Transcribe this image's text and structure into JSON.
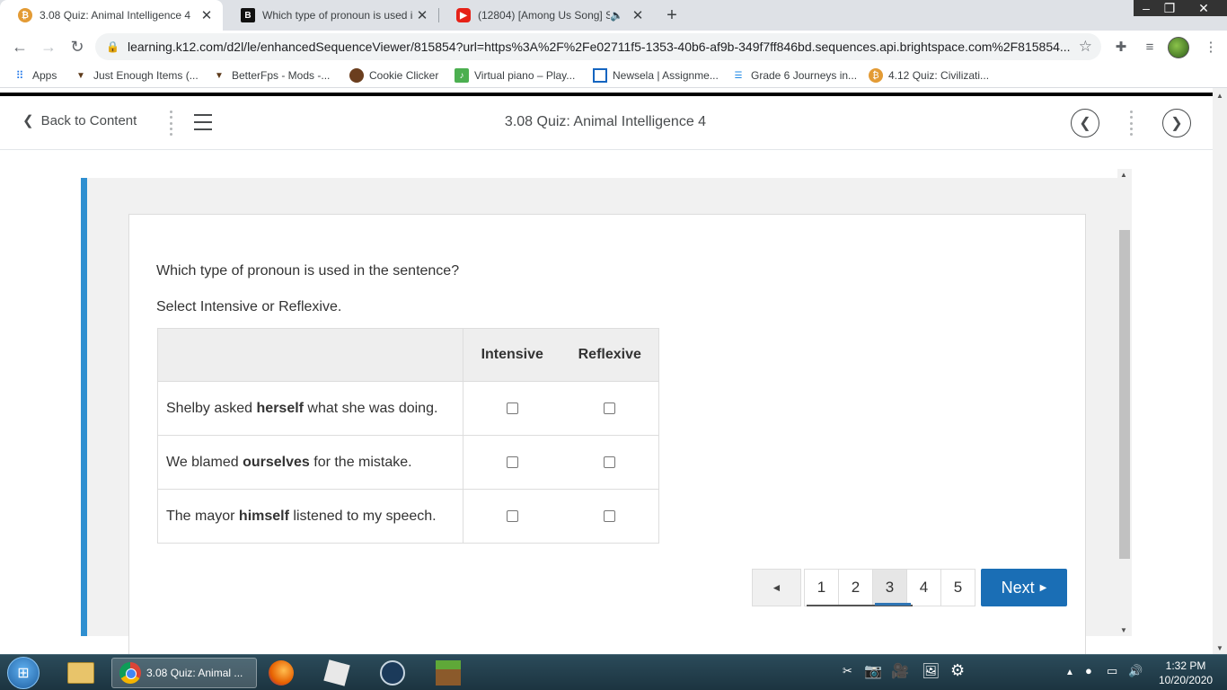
{
  "browser": {
    "tabs": [
      {
        "title": "3.08 Quiz: Animal Intelligence 4",
        "favicon": "k12-icon",
        "active": true
      },
      {
        "title": "Which type of pronoun is used in",
        "favicon": "brainly-icon",
        "active": false
      },
      {
        "title": "(12804) [Among Us Song] Sh",
        "favicon": "youtube-icon",
        "active": false
      }
    ],
    "new_tab": "+",
    "url": "learning.k12.com/d2l/le/enhancedSequenceViewer/815854?url=https%3A%2F%2Fe02711f5-1353-40b6-af9b-349f7ff846bd.sequences.api.brightspace.com%2F815854...",
    "bookmarks": [
      {
        "label": "Apps",
        "icon": "apps-grid-icon"
      },
      {
        "label": "Just Enough Items (...",
        "icon": "anvil-icon"
      },
      {
        "label": "BetterFps - Mods -...",
        "icon": "anvil-icon"
      },
      {
        "label": "Cookie Clicker",
        "icon": "cookie-icon"
      },
      {
        "label": "Virtual piano – Play...",
        "icon": "music-note-icon"
      },
      {
        "label": "Newsela | Assignme...",
        "icon": "newsela-icon"
      },
      {
        "label": "Grade 6 Journeys in...",
        "icon": "stack-icon"
      },
      {
        "label": "4.12 Quiz: Civilizati...",
        "icon": "k12-icon"
      }
    ]
  },
  "nav": {
    "back_label": "Back to Content",
    "title": "3.08 Quiz: Animal Intelligence 4"
  },
  "quiz": {
    "question": "Which type of pronoun is used in the sentence?",
    "instruction": "Select Intensive or Reflexive.",
    "columns": [
      "Intensive",
      "Reflexive"
    ],
    "rows": [
      {
        "before": "Shelby asked ",
        "bold": "herself",
        "after": " what she was doing."
      },
      {
        "before": "We blamed ",
        "bold": "ourselves",
        "after": " for the mistake."
      },
      {
        "before": "The mayor ",
        "bold": "himself",
        "after": " listened to my speech."
      }
    ]
  },
  "pager": {
    "prev": "◄",
    "pages": [
      "1",
      "2",
      "3",
      "4",
      "5"
    ],
    "current_page": "3",
    "next_label": "Next"
  },
  "taskbar": {
    "active_window": "3.08 Quiz: Animal ...",
    "time": "1:32 PM",
    "date": "10/20/2020"
  },
  "colors": {
    "accent": "#2f8fd0",
    "next_button": "#1a6eb5"
  }
}
